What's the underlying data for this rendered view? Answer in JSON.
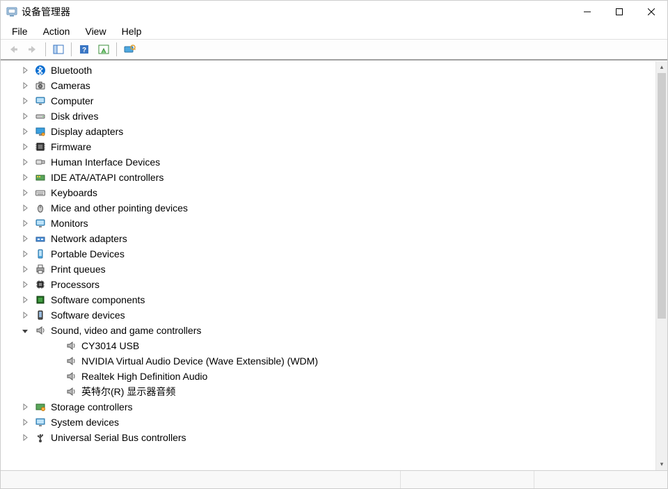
{
  "window": {
    "title": "设备管理器"
  },
  "menu": {
    "file": "File",
    "action": "Action",
    "view": "View",
    "help": "Help"
  },
  "tree": {
    "nodes": [
      {
        "icon": "bluetooth",
        "label": "Bluetooth",
        "expanded": false
      },
      {
        "icon": "camera",
        "label": "Cameras",
        "expanded": false
      },
      {
        "icon": "monitor",
        "label": "Computer",
        "expanded": false
      },
      {
        "icon": "disk",
        "label": "Disk drives",
        "expanded": false
      },
      {
        "icon": "display",
        "label": "Display adapters",
        "expanded": false
      },
      {
        "icon": "firmware",
        "label": "Firmware",
        "expanded": false
      },
      {
        "icon": "hid",
        "label": "Human Interface Devices",
        "expanded": false
      },
      {
        "icon": "ide",
        "label": "IDE ATA/ATAPI controllers",
        "expanded": false
      },
      {
        "icon": "keyboard",
        "label": "Keyboards",
        "expanded": false
      },
      {
        "icon": "mouse",
        "label": "Mice and other pointing devices",
        "expanded": false
      },
      {
        "icon": "monitor",
        "label": "Monitors",
        "expanded": false
      },
      {
        "icon": "network",
        "label": "Network adapters",
        "expanded": false
      },
      {
        "icon": "portable",
        "label": "Portable Devices",
        "expanded": false
      },
      {
        "icon": "printer",
        "label": "Print queues",
        "expanded": false
      },
      {
        "icon": "cpu",
        "label": "Processors",
        "expanded": false
      },
      {
        "icon": "swcomp",
        "label": "Software components",
        "expanded": false
      },
      {
        "icon": "swdev",
        "label": "Software devices",
        "expanded": false
      },
      {
        "icon": "sound",
        "label": "Sound, video and game controllers",
        "expanded": true,
        "children": [
          {
            "icon": "sound",
            "label": "CY3014 USB"
          },
          {
            "icon": "sound",
            "label": "NVIDIA Virtual Audio Device (Wave Extensible) (WDM)"
          },
          {
            "icon": "sound",
            "label": "Realtek High Definition Audio"
          },
          {
            "icon": "sound",
            "label": "英特尔(R) 显示器音频"
          }
        ]
      },
      {
        "icon": "storage",
        "label": "Storage controllers",
        "expanded": false
      },
      {
        "icon": "system",
        "label": "System devices",
        "expanded": false
      },
      {
        "icon": "usb",
        "label": "Universal Serial Bus controllers",
        "expanded": false
      }
    ]
  }
}
